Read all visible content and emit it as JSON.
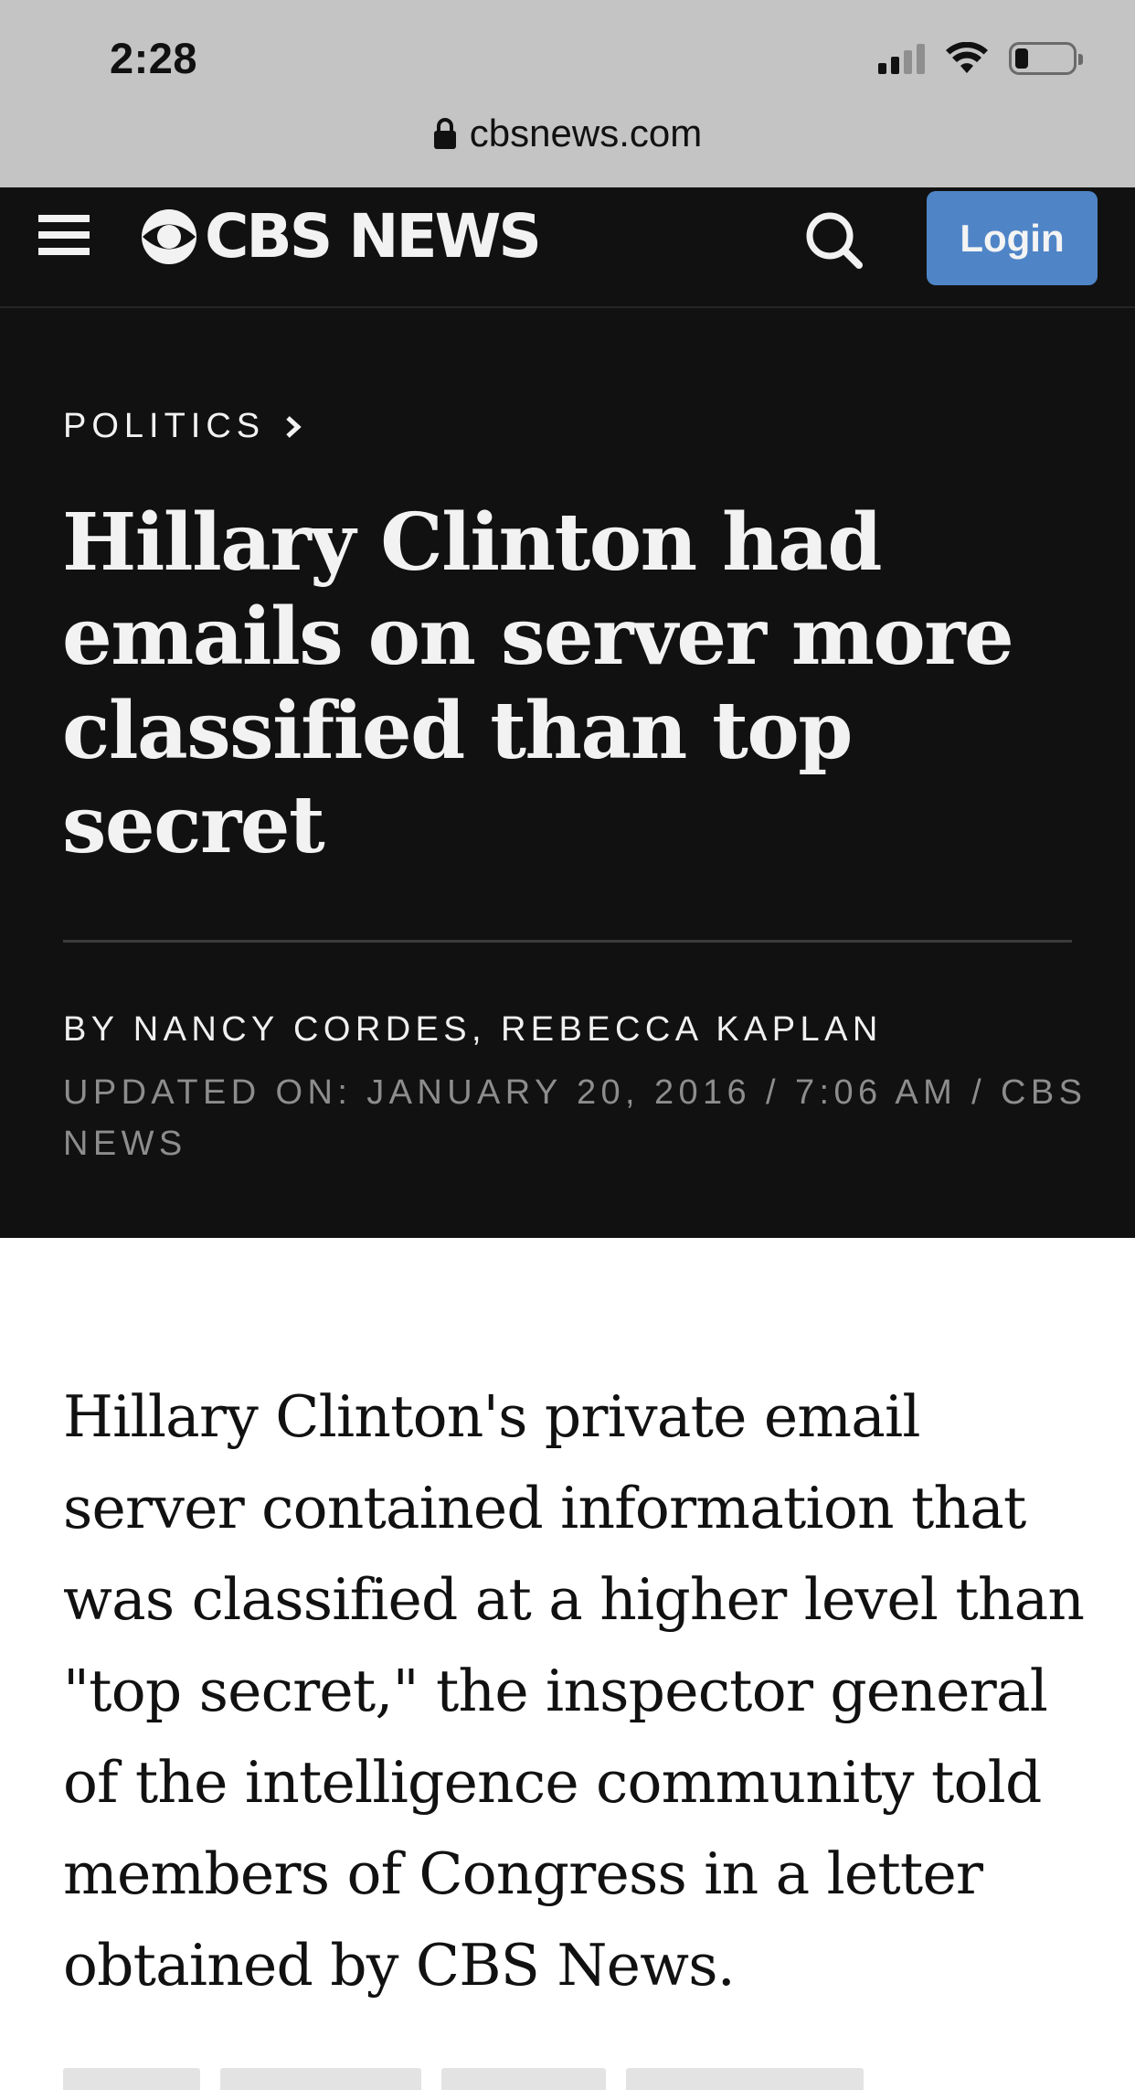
{
  "status_bar": {
    "time": "2:28",
    "signal_bars": 4,
    "signal_bars_active": 2,
    "battery_level": 0.2
  },
  "browser": {
    "url": "cbsnews.com",
    "lock_icon": "lock-icon"
  },
  "header": {
    "menu_icon": "hamburger-menu-icon",
    "logo_text": "CBS NEWS",
    "search_icon": "search-icon",
    "login_label": "Login",
    "login_color": "#4f85c7",
    "background": "#111111"
  },
  "article": {
    "section": "POLITICS",
    "section_chevron": "chevron-right-icon",
    "headline": "Hillary Clinton had emails on server more classified than top secret",
    "byline": "BY NANCY CORDES, REBECCA KAPLAN",
    "meta": "UPDATED ON: JANUARY 20, 2016 / 7:06 AM / CBS NEWS",
    "lead_paragraph": "Hillary Clinton's private email server contained information that was classified at a higher level than \"top secret,\" the inspector general of the intelligence community told members of Congress in a letter obtained by CBS News."
  }
}
